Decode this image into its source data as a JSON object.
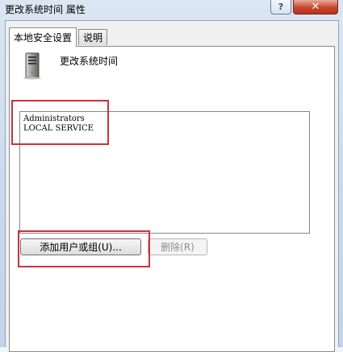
{
  "window": {
    "title": "更改系统时间 属性",
    "help_label": "?",
    "close_label": "✕"
  },
  "tabs": [
    {
      "label": "本地安全设置",
      "active": true
    },
    {
      "label": "说明",
      "active": false
    }
  ],
  "policy": {
    "name": "更改系统时间",
    "icon": "server-icon"
  },
  "accounts": {
    "items": [
      "Administrators",
      "LOCAL SERVICE"
    ]
  },
  "buttons": {
    "add_label": "添加用户或组(U)...",
    "remove_label": "删除(R)"
  },
  "colors": {
    "highlight": "#c9333a"
  }
}
